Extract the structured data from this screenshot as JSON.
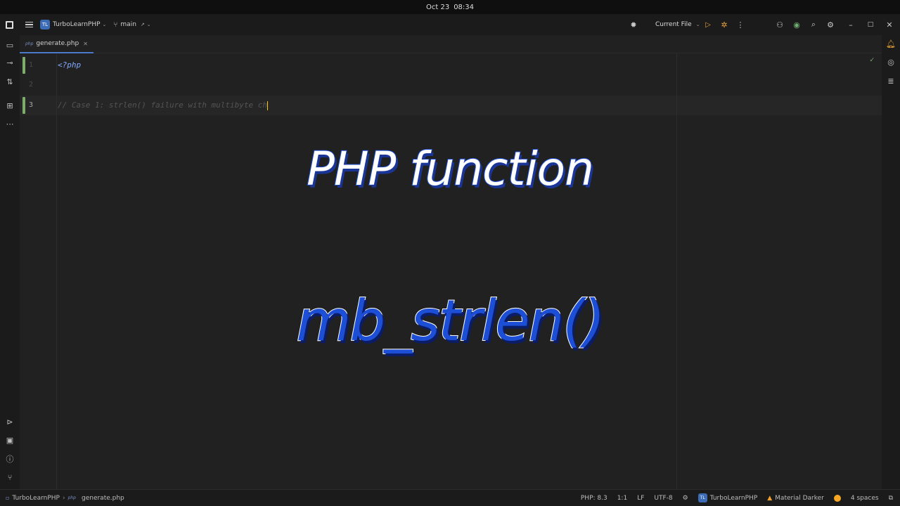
{
  "system_bar": {
    "date": "Oct 23",
    "time": "08:34"
  },
  "titlebar": {
    "project_badge": "TL",
    "project_name": "TurboLearnPHP",
    "branch": "main",
    "run_config": "Current File"
  },
  "tabs": [
    {
      "badge": "php",
      "label": "generate.php"
    }
  ],
  "editor": {
    "lines": [
      {
        "number": "1",
        "text": "<?php"
      },
      {
        "number": "2",
        "text": ""
      },
      {
        "number": "3",
        "text": "// Case 1: strlen() failure with multibyte ch"
      }
    ]
  },
  "overlay": {
    "title": "PHP function",
    "function": "mb_strlen()"
  },
  "breadcrumb": {
    "project": "TurboLearnPHP",
    "file_badge": "php",
    "file": "generate.php"
  },
  "status": {
    "php_version": "PHP: 8.3",
    "position": "1:1",
    "line_ending": "LF",
    "encoding": "UTF-8",
    "project_badge": "TL",
    "project": "TurboLearnPHP",
    "theme": "Material Darker",
    "indent": "4 spaces"
  },
  "colors": {
    "accent": "#3b6cb5",
    "overlay_blue": "#1d4fd6",
    "run_orange": "#e8a23a",
    "vcs_green": "#7dad6b"
  },
  "icons": {
    "left_strip": [
      "folder-icon",
      "commit-icon",
      "pull-request-icon",
      "structure-icon",
      "more-icon",
      "run-icon",
      "terminal-icon",
      "problems-icon",
      "git-icon"
    ],
    "right_strip": [
      "notifications-icon",
      "ai-assistant-icon",
      "database-icon"
    ]
  }
}
